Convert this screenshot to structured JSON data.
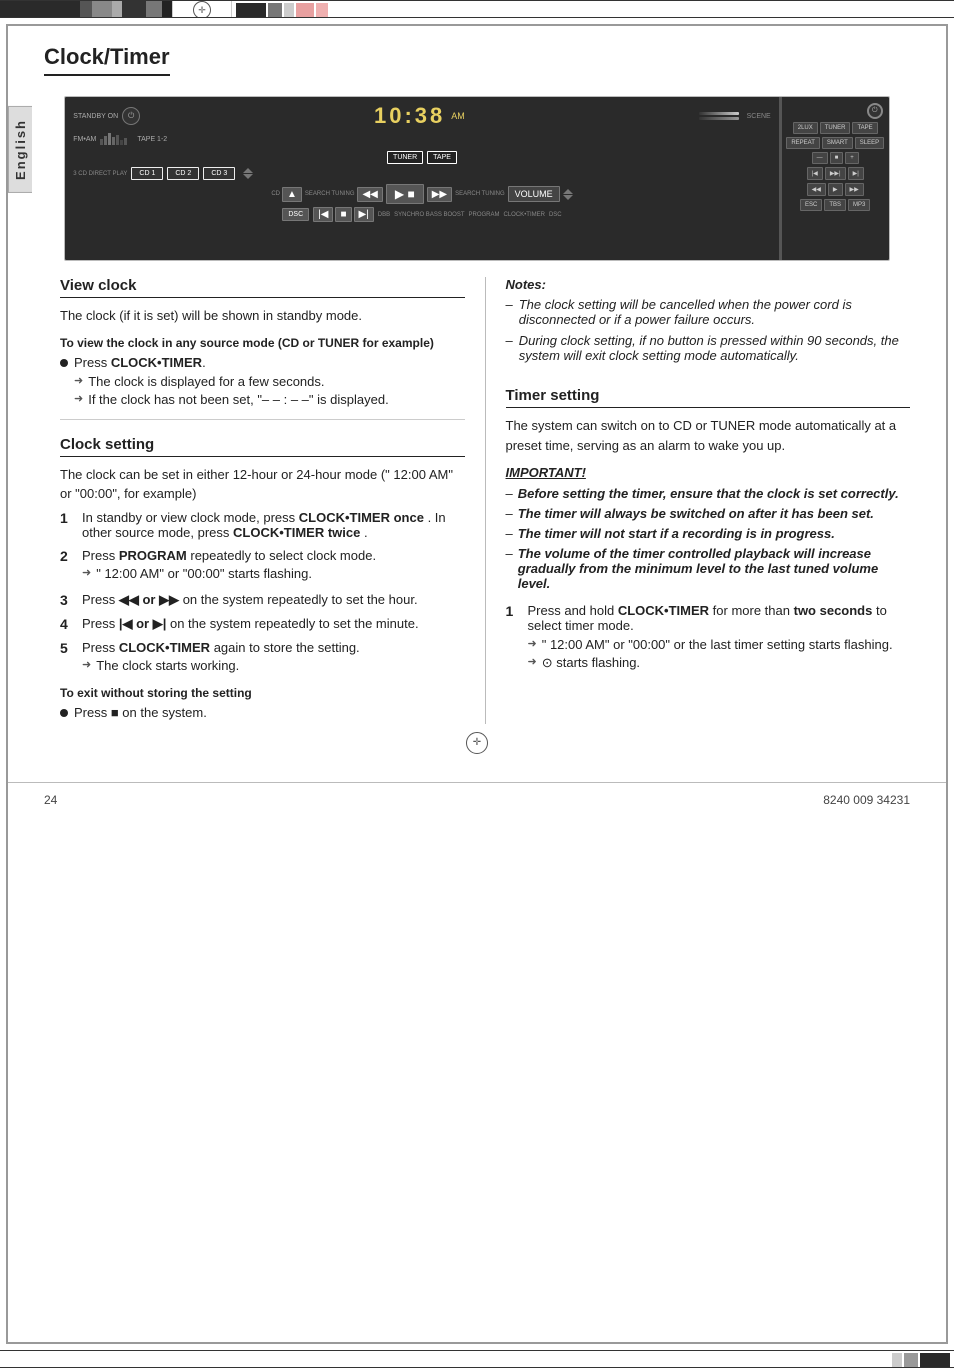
{
  "page": {
    "title": "Clock/Timer",
    "page_number": "24",
    "catalog_number": "8240 009 34231"
  },
  "sidebar": {
    "language_label": "English"
  },
  "stereo": {
    "display_time": "10:38",
    "display_sub": "AM",
    "sections": {
      "tuner": "TUNER",
      "tape": "TAPE",
      "cd1": "CD 1",
      "cd2": "CD 2",
      "cd3": "CD 3",
      "cd_direct": "3 CD DIRECT PLAY",
      "dsc": "DSC",
      "fm_am": "FM•AM",
      "tape_label": "TAPE 1-2",
      "volume_label": "VOLUME",
      "standby_on": "STANDBY ON"
    }
  },
  "view_clock": {
    "header": "View clock",
    "intro": "The clock (if it is set) will be shown in standby mode.",
    "subheader": "To view the clock in any source mode (CD or TUNER for example)",
    "bullet1": "Press CLOCK•TIMER.",
    "arrow1": "The clock is displayed for a few seconds.",
    "arrow2": "If the clock has not been set, \"– – : – –\" is displayed."
  },
  "clock_setting": {
    "header": "Clock setting",
    "intro": "The clock can be set in either 12-hour or 24-hour mode (\" 12:00  AM\" or \"00:00\", for example)",
    "step1": {
      "num": "1",
      "text": "In standby or view clock mode, press",
      "bold1": "CLOCK•TIMER once",
      "text2": ".  In other source mode, press",
      "bold2": "CLOCK•TIMER twice",
      "text3": "."
    },
    "step2": {
      "num": "2",
      "text": "Press",
      "bold": "PROGRAM",
      "text2": "repeatedly to select clock mode.",
      "arrow": "\" 12:00  AM\" or \"00:00\" starts flashing."
    },
    "step3": {
      "num": "3",
      "text": "Press",
      "bold": "◀◀ or ▶▶",
      "text2": "on the system repeatedly to set the hour."
    },
    "step4": {
      "num": "4",
      "text": "Press",
      "bold": "|◀ or ▶|",
      "text2": "on the system repeatedly to set the minute."
    },
    "step5": {
      "num": "5",
      "text": "Press",
      "bold": "CLOCK•TIMER",
      "text2": "again to store the setting.",
      "arrow": "The clock starts working."
    },
    "exit_subheader": "To exit without storing the setting",
    "exit_bullet": "Press ■ on the system."
  },
  "notes": {
    "label": "Notes:",
    "note1": "The clock setting will be cancelled when the power cord is disconnected or if a power failure occurs.",
    "note2": "During clock setting, if no button is pressed within 90 seconds, the system will exit clock setting mode automatically."
  },
  "timer_setting": {
    "header": "Timer setting",
    "intro": "The system can switch on to CD or TUNER mode automatically at a preset time, serving as an alarm to wake you up.",
    "important_header": "IMPORTANT!",
    "imp1": "Before setting the timer, ensure that the clock is set correctly.",
    "imp2": "The timer will always be switched on after it has been set.",
    "imp3": "The timer will not start if a recording is in progress.",
    "imp4": "The volume of the timer controlled playback will increase gradually from the minimum level to the last tuned volume level.",
    "step1": {
      "num": "1",
      "text": "Press and hold",
      "bold": "CLOCK•TIMER",
      "text2": "for more than",
      "bold2": "two seconds",
      "text3": "to select timer mode.",
      "arrow1": "\" 12:00  AM\" or \"00:00\" or the last timer setting starts flashing.",
      "arrow2": "⊙ starts flashing."
    }
  }
}
